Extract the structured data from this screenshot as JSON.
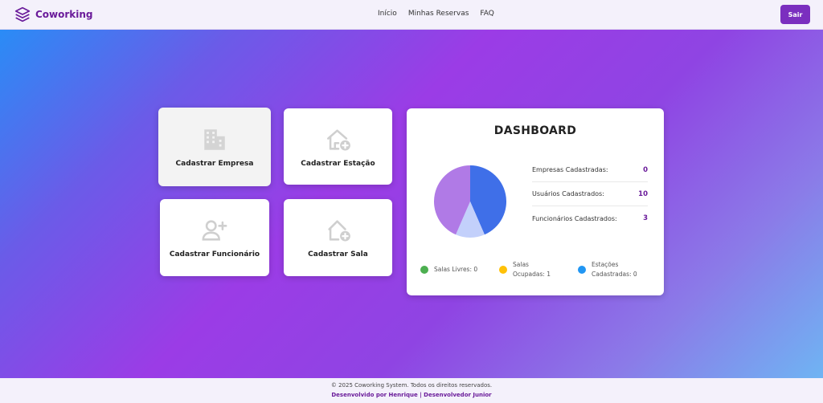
{
  "header": {
    "brand": "Coworking",
    "nav": [
      "Início",
      "Minhas Reservas",
      "FAQ"
    ],
    "logout_label": "Sair"
  },
  "cards": {
    "empresa": "Cadastrar Empresa",
    "estacao": "Cadastrar Estação",
    "funcionario": "Cadastrar Funcionário",
    "sala": "Cadastrar Sala"
  },
  "dashboard": {
    "title": "DASHBOARD",
    "stats": [
      {
        "label": "Empresas Cadastradas:",
        "value": "0"
      },
      {
        "label": "Usuários Cadastrados:",
        "value": "10"
      },
      {
        "label": "Funcionários Cadastrados:",
        "value": "3"
      }
    ],
    "legend": [
      {
        "label_line1": "Salas Livres: 0",
        "label_line2": "",
        "color": "#4caf50"
      },
      {
        "label_line1": "Salas",
        "label_line2": "Ocupadas: 1",
        "color": "#ffc107"
      },
      {
        "label_line1": "Estações",
        "label_line2": "Cadastradas: 0",
        "color": "#2196f3"
      }
    ]
  },
  "chart_data": {
    "type": "pie",
    "slices": [
      {
        "value": 0,
        "color": "#4caf50"
      },
      {
        "value": 10,
        "color": "#3f6fe8"
      },
      {
        "value": 3,
        "color": "#c3d0fb"
      },
      {
        "value": 10,
        "color": "#b07ae6"
      }
    ]
  },
  "footer": {
    "copyright": "© 2025 Coworking System. Todos os direitos reservados.",
    "developer": "Desenvolvido por Henrique | Desenvolvedor Junior"
  },
  "colors": {
    "brand": "#6a1b9a",
    "logout_button": "#7b2fbf"
  },
  "icons": [
    "layers-icon",
    "building-icon",
    "house-add-icon",
    "user-add-icon",
    "house-add-icon"
  ]
}
